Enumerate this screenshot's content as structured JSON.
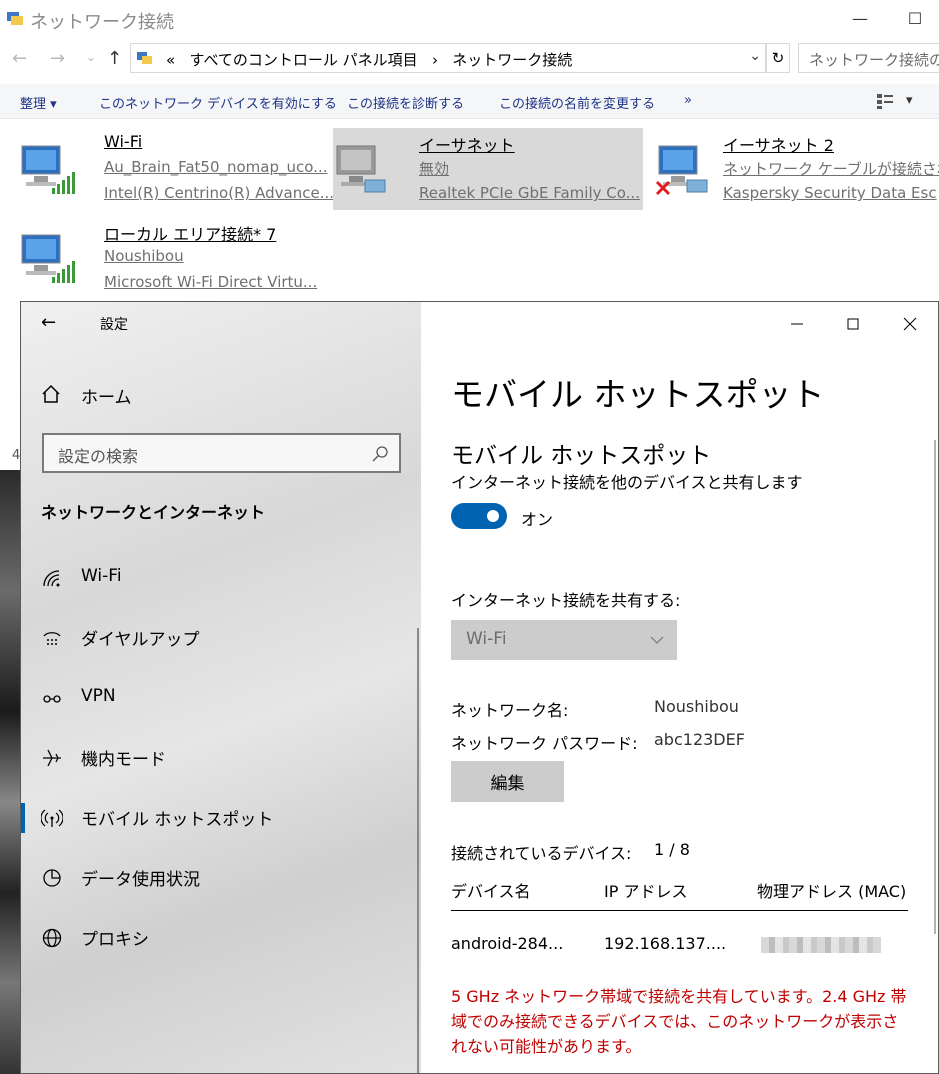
{
  "explorer": {
    "title": "ネットワーク接続",
    "address": {
      "chevron": "«",
      "part1": "すべてのコントロール パネル項目",
      "separator": "›",
      "part2": "ネットワーク接続"
    },
    "search_placeholder": "ネットワーク接続の",
    "commands": {
      "organize": "整理 ▾",
      "enable": "このネットワーク デバイスを有効にする",
      "diagnose": "この接続を診断する",
      "rename": "この接続の名前を変更する",
      "more": "»"
    },
    "connections": [
      {
        "name": "Wi-Fi",
        "status": "Au_Brain_Fat50_nomap_uco...",
        "device": "Intel(R) Centrino(R) Advance..."
      },
      {
        "name": "イーサネット",
        "status": "無効",
        "device": "Realtek PCIe GbE Family Co..."
      },
      {
        "name": "イーサネット 2",
        "status": "ネットワーク ケーブルが接続され",
        "device": "Kaspersky Security Data Esc"
      },
      {
        "name": "ローカル エリア接続* 7",
        "status": "Noushibou",
        "device": "Microsoft Wi-Fi Direct Virtu..."
      }
    ],
    "stray_text": "4"
  },
  "settings": {
    "window_title": "設定",
    "home": "ホーム",
    "search_placeholder": "設定の検索",
    "section": "ネットワークとインターネット",
    "nav": [
      {
        "label": "Wi-Fi",
        "icon": "wifi-icon"
      },
      {
        "label": "ダイヤルアップ",
        "icon": "dialup-icon"
      },
      {
        "label": "VPN",
        "icon": "vpn-icon"
      },
      {
        "label": "機内モード",
        "icon": "airplane-icon"
      },
      {
        "label": "モバイル ホットスポット",
        "icon": "hotspot-icon",
        "active": true
      },
      {
        "label": "データ使用状況",
        "icon": "data-usage-icon"
      },
      {
        "label": "プロキシ",
        "icon": "globe-icon"
      }
    ],
    "page_title": "モバイル ホットスポット",
    "section_title": "モバイル ホットスポット",
    "section_desc": "インターネット接続を他のデバイスと共有します",
    "toggle_state": "オン",
    "share_label": "インターネット接続を共有する:",
    "share_value": "Wi-Fi",
    "network_name_label": "ネットワーク名:",
    "network_name_value": "Noushibou",
    "password_label": "ネットワーク パスワード:",
    "password_value": "abc123DEF",
    "edit_button": "編集",
    "connected_label": "接続されているデバイス:",
    "connected_value": "1 / 8",
    "table_headers": {
      "device": "デバイス名",
      "ip": "IP アドレス",
      "mac": "物理アドレス (MAC)"
    },
    "devices": [
      {
        "name": "android-284...",
        "ip": "192.168.137...."
      }
    ],
    "warning": "5 GHz ネットワーク帯域で接続を共有しています。2.4 GHz 帯域でのみ接続できるデバイスでは、このネットワークが表示されない可能性があります。",
    "accent": "#0063b1",
    "warning_color": "#c00000"
  }
}
